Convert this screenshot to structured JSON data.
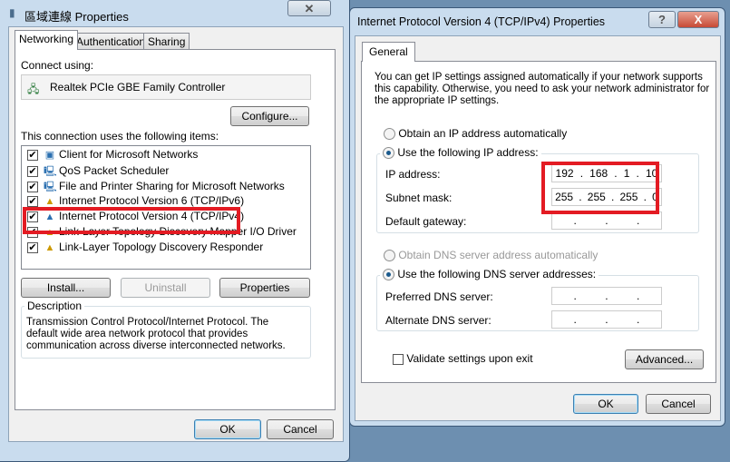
{
  "left": {
    "title": "區域連線 Properties",
    "tabs": [
      "Networking",
      "Authentication",
      "Sharing"
    ],
    "connect_using": "Connect using:",
    "adapter": "Realtek PCIe GBE Family Controller",
    "configure": "Configure...",
    "items_label": "This connection uses the following items:",
    "items": [
      {
        "label": "Client for Microsoft Networks",
        "checked": true,
        "icon": "network-client-icon"
      },
      {
        "label": "QoS Packet Scheduler",
        "checked": true,
        "icon": "computer-icon"
      },
      {
        "label": "File and Printer Sharing for Microsoft Networks",
        "checked": true,
        "icon": "computer-icon"
      },
      {
        "label": "Internet Protocol Version 6 (TCP/IPv6)",
        "checked": true,
        "icon": "protocol-icon"
      },
      {
        "label": "Internet Protocol Version 4 (TCP/IPv4)",
        "checked": true,
        "icon": "protocol-icon",
        "highlighted": true
      },
      {
        "label": "Link-Layer Topology Discovery Mapper I/O Driver",
        "checked": true,
        "icon": "protocol-icon"
      },
      {
        "label": "Link-Layer Topology Discovery Responder",
        "checked": true,
        "icon": "protocol-icon"
      }
    ],
    "install": "Install...",
    "uninstall": "Uninstall",
    "properties": "Properties",
    "description_label": "Description",
    "description": "Transmission Control Protocol/Internet Protocol. The default wide area network protocol that provides communication across diverse interconnected networks.",
    "ok": "OK",
    "cancel": "Cancel"
  },
  "right": {
    "title": "Internet Protocol Version 4 (TCP/IPv4) Properties",
    "tab": "General",
    "intro": "You can get IP settings assigned automatically if your network supports this capability. Otherwise, you need to ask your network administrator for the appropriate IP settings.",
    "obtain_ip": "Obtain an IP address automatically",
    "use_ip": "Use the following IP address:",
    "ip_label": "IP address:",
    "ip": [
      "192",
      "168",
      "1",
      "10"
    ],
    "mask_label": "Subnet mask:",
    "mask": [
      "255",
      "255",
      "255",
      "0"
    ],
    "gateway_label": "Default gateway:",
    "obtain_dns": "Obtain DNS server address automatically",
    "use_dns": "Use the following DNS server addresses:",
    "pref_dns": "Preferred DNS server:",
    "alt_dns": "Alternate DNS server:",
    "validate": "Validate settings upon exit",
    "advanced": "Advanced...",
    "ok": "OK",
    "cancel": "Cancel",
    "help": "?",
    "close": "X"
  },
  "highlight_color": "#e31b23"
}
